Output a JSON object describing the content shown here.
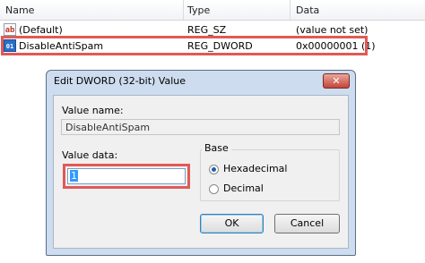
{
  "columns": {
    "name": "Name",
    "type": "Type",
    "data": "Data"
  },
  "rows": [
    {
      "icon": "ab",
      "name": "(Default)",
      "type": "REG_SZ",
      "data": "(value not set)"
    },
    {
      "icon": "011\n110",
      "name": "DisableAntiSpam",
      "type": "REG_DWORD",
      "data": "0x00000001 (1)"
    }
  ],
  "dialog": {
    "title": "Edit DWORD (32-bit) Value",
    "close_glyph": "✕",
    "value_name_label": "Value name:",
    "value_name": "DisableAntiSpam",
    "value_data_label": "Value data:",
    "value_data": "1",
    "base_label": "Base",
    "base_options": [
      "Hexadecimal",
      "Decimal"
    ],
    "base_selected": "Hexadecimal",
    "ok_label": "OK",
    "cancel_label": "Cancel"
  },
  "colors": {
    "highlight": "#e05a55",
    "selection": "#3399ff"
  }
}
